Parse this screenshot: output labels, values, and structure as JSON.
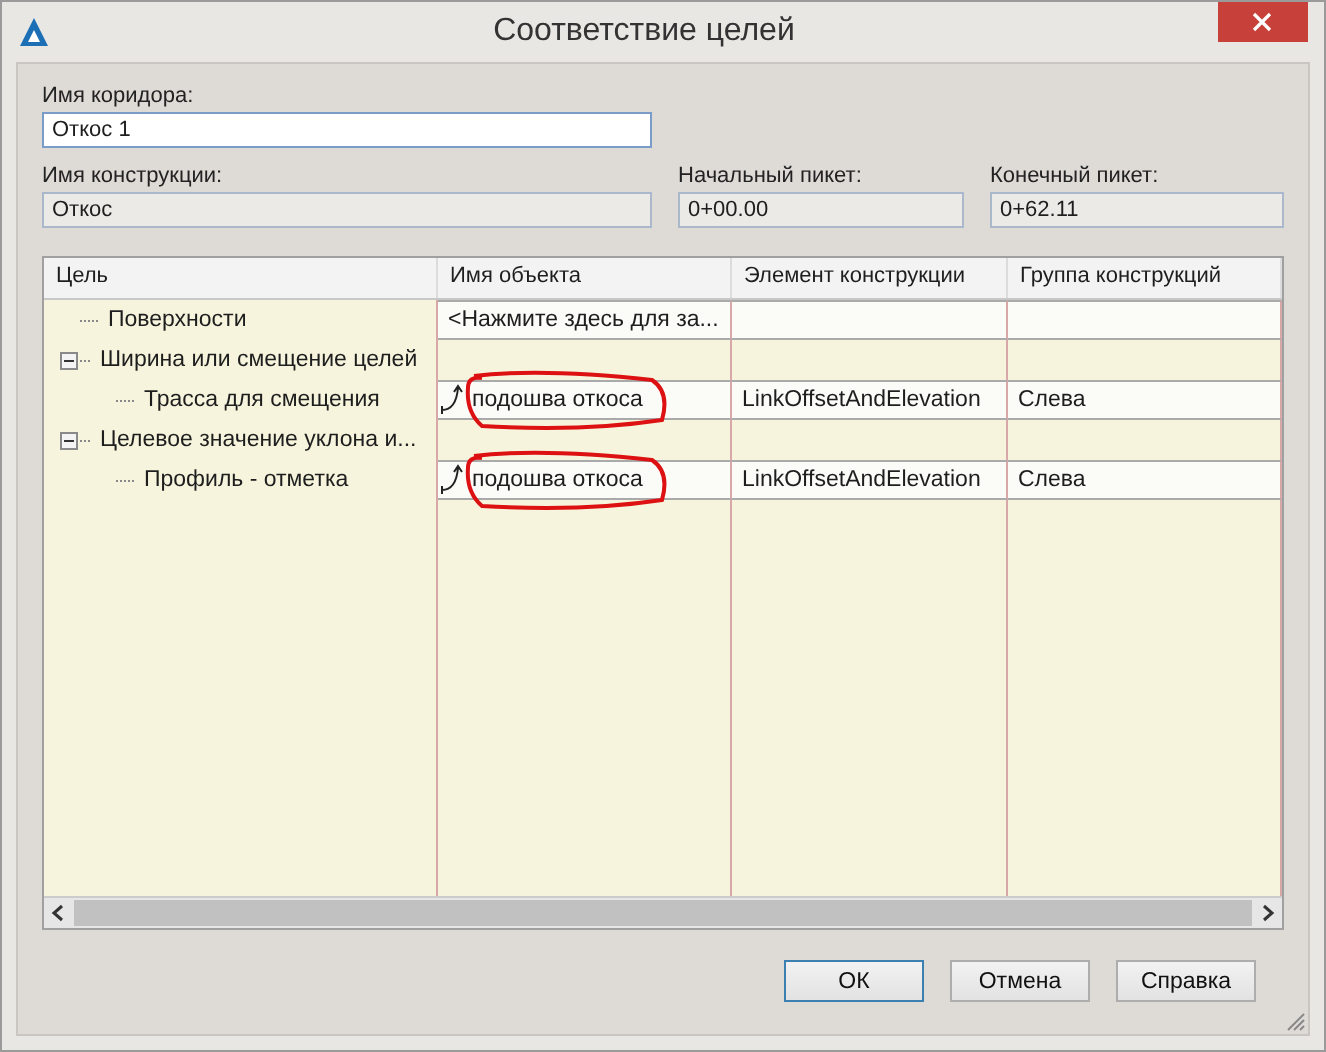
{
  "window": {
    "title": "Соответствие целей"
  },
  "corridor": {
    "label": "Имя коридора:",
    "value": "Откос 1"
  },
  "assembly": {
    "label": "Имя конструкции:",
    "value": "Откос"
  },
  "start_station": {
    "label": "Начальный пикет:",
    "value": "0+00.00"
  },
  "end_station": {
    "label": "Конечный пикет:",
    "value": "0+62.11"
  },
  "table": {
    "columns": [
      "Цель",
      "Имя объекта",
      "Элемент конструкции",
      "Группа конструкций"
    ],
    "rows": [
      {
        "label": "Поверхности",
        "object_name": "<Нажмите здесь для за..."
      },
      {
        "label": "Ширина или смещение целей",
        "expanded": true,
        "children": [
          {
            "label": "Трасса для смещения",
            "object_name": "подошва откоса",
            "linked": true,
            "circled": true,
            "element": "LinkOffsetAndElevation",
            "group": "Слева"
          }
        ]
      },
      {
        "label": "Целевое значение уклона и...",
        "expanded": true,
        "children": [
          {
            "label": "Профиль - отметка",
            "object_name": "подошва откоса",
            "linked": true,
            "circled": true,
            "element": "LinkOffsetAndElevation",
            "group": "Слева"
          }
        ]
      }
    ]
  },
  "buttons": [
    {
      "label": "ОК",
      "default": true
    },
    {
      "label": "Отмена",
      "default": false
    },
    {
      "label": "Справка",
      "default": false
    }
  ]
}
